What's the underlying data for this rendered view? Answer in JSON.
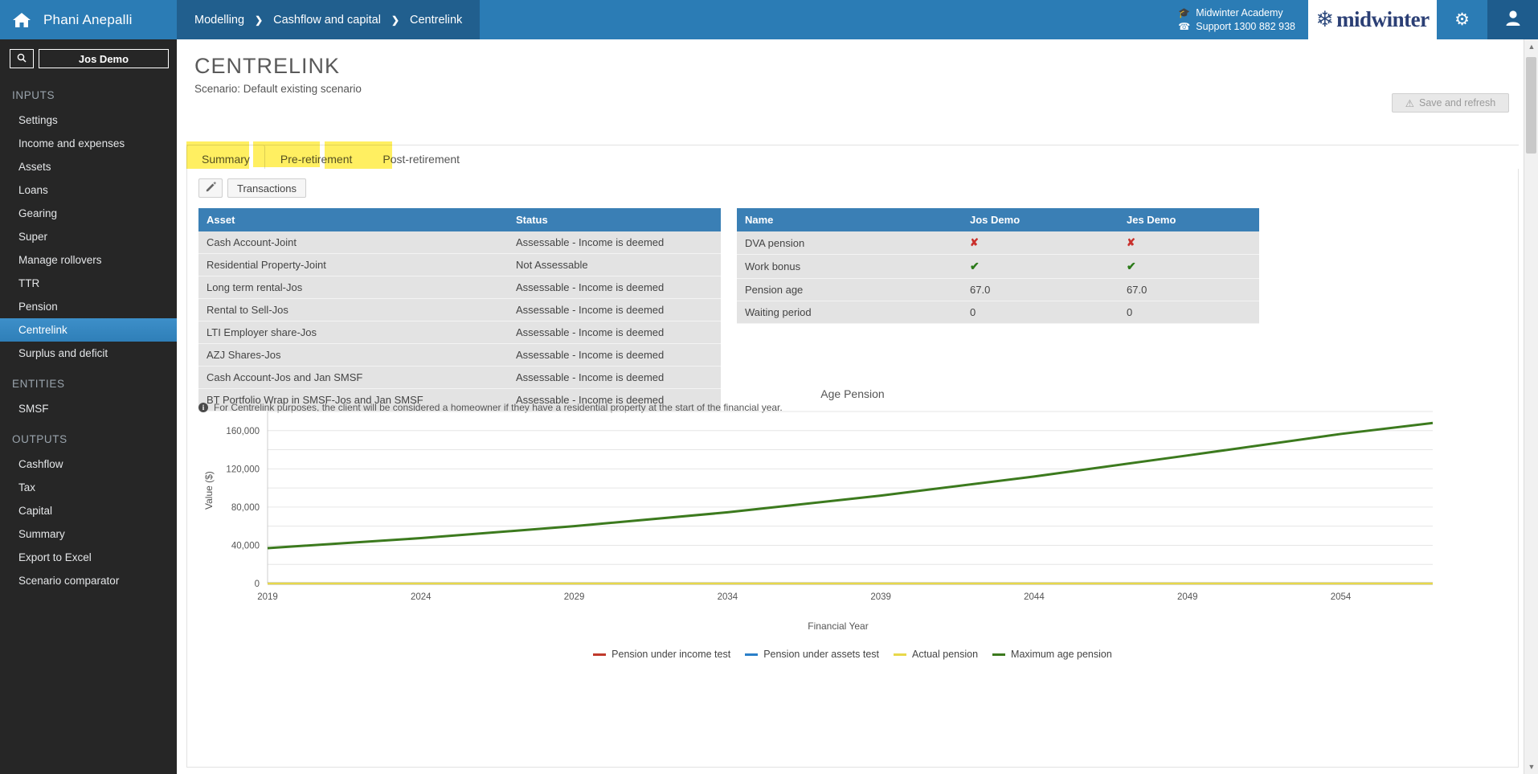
{
  "topbar": {
    "home_icon": "home-icon",
    "user_name": "Phani Anepalli",
    "breadcrumbs": [
      "Modelling",
      "Cashflow and capital",
      "Centrelink"
    ],
    "academy_label": "Midwinter Academy",
    "academy_icon": "graduation-cap-icon",
    "support_label": "Support 1300 882 938",
    "support_icon": "phone-icon",
    "logo_text": "midwinter",
    "logo_icon": "snowflake-icon",
    "gear_icon": "gear-icon",
    "person_icon": "person-icon"
  },
  "sidebar": {
    "search_icon": "search-icon",
    "client_name": "Jos Demo",
    "groups": [
      {
        "title": "INPUTS",
        "items": [
          {
            "label": "Settings",
            "active": false
          },
          {
            "label": "Income and expenses",
            "active": false
          },
          {
            "label": "Assets",
            "active": false
          },
          {
            "label": "Loans",
            "active": false
          },
          {
            "label": "Gearing",
            "active": false
          },
          {
            "label": "Super",
            "active": false
          },
          {
            "label": "Manage rollovers",
            "active": false
          },
          {
            "label": "TTR",
            "active": false
          },
          {
            "label": "Pension",
            "active": false
          },
          {
            "label": "Centrelink",
            "active": true
          },
          {
            "label": "Surplus and deficit",
            "active": false
          }
        ]
      },
      {
        "title": "ENTITIES",
        "items": [
          {
            "label": "SMSF",
            "active": false
          }
        ]
      },
      {
        "title": "OUTPUTS",
        "items": [
          {
            "label": "Cashflow",
            "active": false
          },
          {
            "label": "Tax",
            "active": false
          },
          {
            "label": "Capital",
            "active": false
          },
          {
            "label": "Summary",
            "active": false
          },
          {
            "label": "Export to Excel",
            "active": false
          },
          {
            "label": "Scenario comparator",
            "active": false
          }
        ]
      }
    ]
  },
  "page": {
    "title": "CENTRELINK",
    "subtitle": "Scenario: Default existing scenario",
    "save_label": "Save and refresh",
    "save_icon": "warning-icon"
  },
  "tabs": [
    {
      "label": "Summary",
      "active": true
    },
    {
      "label": "Pre-retirement",
      "active": false
    },
    {
      "label": "Post-retirement",
      "active": false
    }
  ],
  "toolbar": {
    "edit_icon": "pencil-icon",
    "transactions_label": "Transactions"
  },
  "asset_table": {
    "headers": [
      "Asset",
      "Status"
    ],
    "rows": [
      [
        "Cash Account-Joint",
        "Assessable - Income is deemed"
      ],
      [
        "Residential Property-Joint",
        "Not Assessable"
      ],
      [
        "Long term rental-Jos",
        "Assessable - Income is deemed"
      ],
      [
        "Rental to Sell-Jos",
        "Assessable - Income is deemed"
      ],
      [
        "LTI Employer share-Jos",
        "Assessable - Income is deemed"
      ],
      [
        "AZJ Shares-Jos",
        "Assessable - Income is deemed"
      ],
      [
        "Cash Account-Jos and Jan SMSF",
        "Assessable - Income is deemed"
      ],
      [
        "BT Portfolio Wrap in SMSF-Jos and Jan SMSF",
        "Assessable - Income is deemed"
      ]
    ]
  },
  "person_table": {
    "headers": [
      "Name",
      "Jos Demo",
      "Jes Demo"
    ],
    "rows": [
      {
        "name": "DVA pension",
        "jos": "✘",
        "jes": "✘",
        "type": "cross"
      },
      {
        "name": "Work bonus",
        "jos": "✔",
        "jes": "✔",
        "type": "check"
      },
      {
        "name": "Pension age",
        "jos": "67.0",
        "jes": "67.0",
        "type": "text"
      },
      {
        "name": "Waiting period",
        "jos": "0",
        "jes": "0",
        "type": "text"
      }
    ]
  },
  "note": {
    "icon": "info-icon",
    "icon_char": "i",
    "text": "For Centrelink purposes, the client will be considered a homeowner if they have a residential property at the start of the financial year."
  },
  "chart_data": {
    "type": "line",
    "title": "Age Pension",
    "xlabel": "Financial Year",
    "ylabel": "Value ($)",
    "xticks": [
      2019,
      2024,
      2029,
      2034,
      2039,
      2044,
      2049,
      2054
    ],
    "yticks": [
      0,
      40000,
      80000,
      120000,
      160000
    ],
    "ytick_labels": [
      "0",
      "40,000",
      "80,000",
      "120,000",
      "160,000"
    ],
    "xlim": [
      2019,
      2057
    ],
    "ylim": [
      0,
      180000
    ],
    "grid": true,
    "legend_position": "bottom",
    "x": [
      2019,
      2024,
      2029,
      2034,
      2039,
      2044,
      2049,
      2054,
      2057
    ],
    "series": [
      {
        "name": "Pension under income test",
        "color": "#c0392b",
        "values": [
          0,
          0,
          0,
          0,
          0,
          0,
          0,
          0,
          0
        ]
      },
      {
        "name": "Pension under assets test",
        "color": "#2a7fc9",
        "values": [
          0,
          0,
          0,
          0,
          0,
          0,
          0,
          0,
          0
        ]
      },
      {
        "name": "Actual pension",
        "color": "#e8d84a",
        "values": [
          0,
          0,
          0,
          0,
          0,
          0,
          0,
          0,
          0
        ]
      },
      {
        "name": "Maximum age pension",
        "color": "#3c7a1e",
        "values": [
          37000,
          47500,
          60000,
          74500,
          92000,
          112000,
          134000,
          156500,
          168000
        ]
      }
    ]
  },
  "scrollbar": {
    "up_arrow": "chevron-up-icon",
    "down_arrow": "chevron-down-icon"
  }
}
